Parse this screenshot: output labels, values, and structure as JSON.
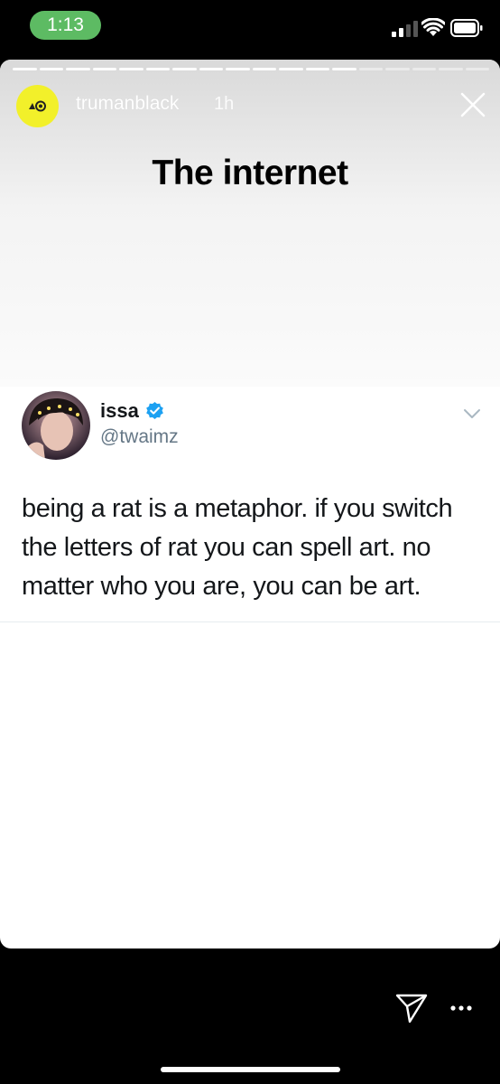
{
  "status_bar": {
    "time": "1:13"
  },
  "story": {
    "username": "trumanblack",
    "time_ago": "1h",
    "caption": "The internet",
    "progress_total": 18,
    "progress_done": 13,
    "avatar_color": "#f2f02a"
  },
  "tweet": {
    "name": "issa",
    "handle": "@twaimz",
    "text": "being a rat is a metaphor. if you switch the letters of rat you can spell art. no matter who you are, you can be art.",
    "verified_color": "#1da1f2"
  },
  "icons": {
    "close": "close-icon",
    "verified": "verified-badge-icon",
    "chevron": "chevron-down-icon",
    "send": "send-icon",
    "more": "more-icon"
  }
}
